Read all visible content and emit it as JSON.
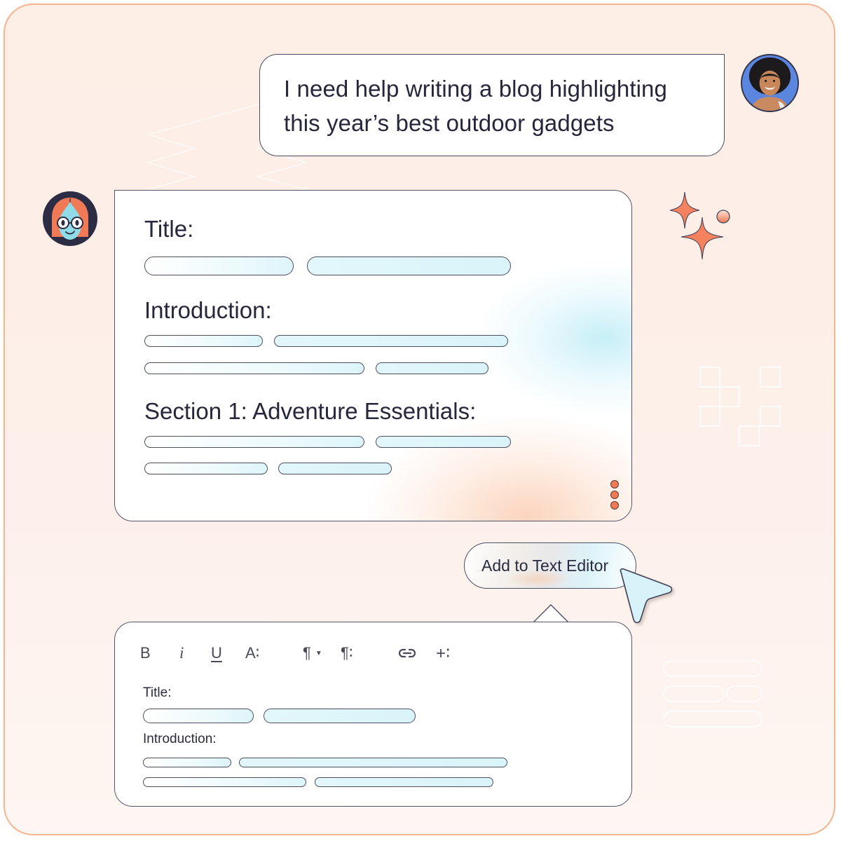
{
  "user_message": {
    "lines": [
      "I need help writing a blog highlighting",
      "this year’s best outdoor gadgets"
    ],
    "avatar": "user-avatar-photo"
  },
  "bot": {
    "avatar": "bot-avatar-illustration",
    "sections": [
      {
        "heading": "Title:"
      },
      {
        "heading": "Introduction:"
      },
      {
        "heading": "Section 1: Adventure Essentials:"
      }
    ],
    "menu_icon": "more-vertical-icon"
  },
  "decorations": {
    "sparkles_icon": "sparkles-icon"
  },
  "action": {
    "add_to_editor_label": "Add to Text Editor",
    "cursor_icon": "pointer-cursor-icon"
  },
  "editor": {
    "toolbar": [
      {
        "name": "bold",
        "glyph": "B"
      },
      {
        "name": "italic",
        "glyph": "i"
      },
      {
        "name": "underline",
        "glyph": "U"
      },
      {
        "name": "font-size",
        "glyph": "A∶"
      },
      {
        "name": "paragraph-style",
        "glyph": "¶"
      },
      {
        "name": "paragraph-options",
        "glyph": "¶∶"
      },
      {
        "name": "link",
        "glyph": "link"
      },
      {
        "name": "insert",
        "glyph": "+∶"
      }
    ],
    "sections": [
      {
        "heading": "Title:"
      },
      {
        "heading": "Introduction:"
      }
    ]
  },
  "colors": {
    "frame_border": "#f6b48e",
    "background": "#fdeee6",
    "text": "#26263c",
    "accent_orange": "#f07a55",
    "accent_cyan": "#d9f4fa",
    "user_avatar_bg": "#5b86df"
  }
}
